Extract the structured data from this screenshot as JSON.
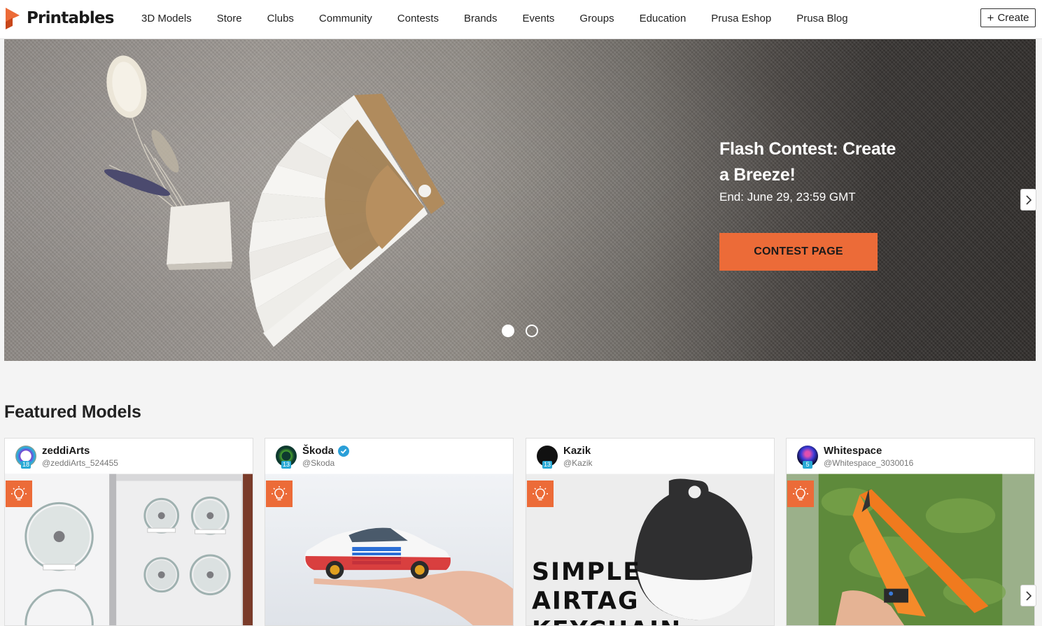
{
  "header": {
    "brand": "Printables",
    "nav": [
      "3D Models",
      "Store",
      "Clubs",
      "Community",
      "Contests",
      "Brands",
      "Events",
      "Groups",
      "Education",
      "Prusa Eshop",
      "Prusa Blog"
    ],
    "create_label": "Create",
    "accent": "#ec6b38"
  },
  "hero": {
    "title": "Flash Contest: Create a Breeze!",
    "subtitle": "End: June 29, 23:59 GMT",
    "button_label": "CONTEST PAGE",
    "slides_total": 2,
    "active_slide": 1
  },
  "featured": {
    "title": "Featured Models",
    "cards": [
      {
        "author": "zeddiArts",
        "handle": "@zeddiArts_524455",
        "level": "18",
        "verified": false,
        "image": "pot-lid-holders"
      },
      {
        "author": "Škoda",
        "handle": "@Skoda",
        "level": "13",
        "verified": true,
        "image": "toy-car-on-hand"
      },
      {
        "author": "Kazik",
        "handle": "@Kazik",
        "level": "13",
        "verified": false,
        "image": "airtag-keychain",
        "image_text": "SIMPLE AIRTAG KEYCHAIN"
      },
      {
        "author": "Whitespace",
        "handle": "@Whitespace_3030016",
        "level": "5",
        "verified": false,
        "image": "orange-flying-wing"
      }
    ]
  }
}
